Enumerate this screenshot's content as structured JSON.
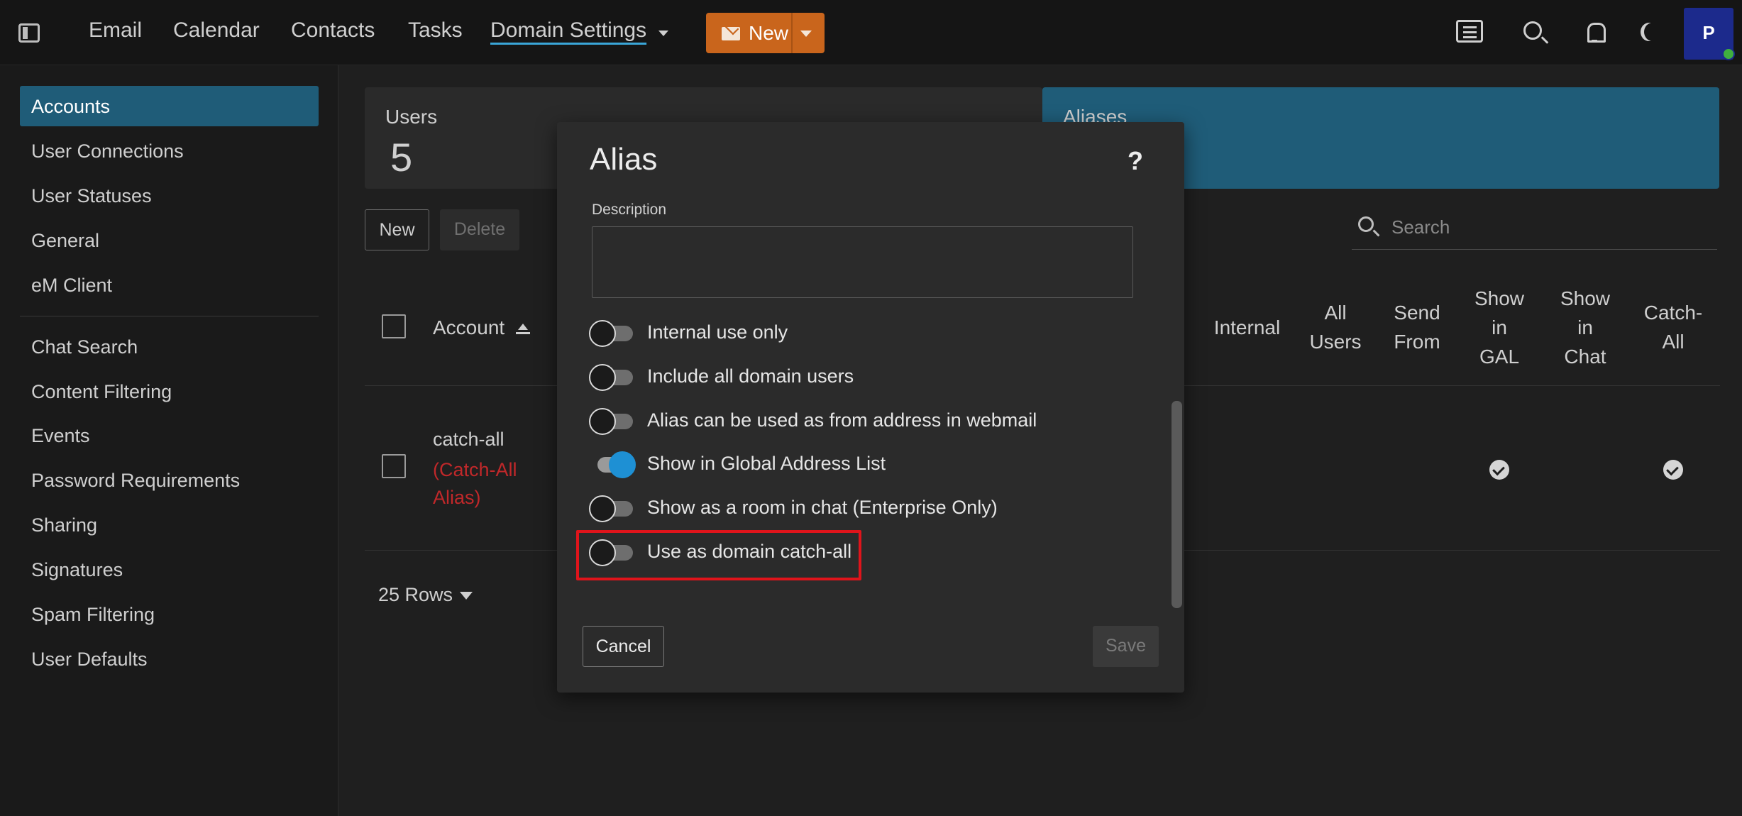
{
  "topbar": {
    "nav": [
      "Email",
      "Calendar",
      "Contacts",
      "Tasks",
      "Domain Settings"
    ],
    "new_label": "New",
    "avatar_initial": "P",
    "accent_color": "#c9651c"
  },
  "sidebar": {
    "group1": [
      "Accounts",
      "User Connections",
      "User Statuses",
      "General",
      "eM Client"
    ],
    "group2": [
      "Chat Search",
      "Content Filtering",
      "Events",
      "Password Requirements",
      "Sharing",
      "Signatures",
      "Spam Filtering",
      "User Defaults"
    ]
  },
  "stats": {
    "users_label": "Users",
    "users_value": "5",
    "aliases_label": "Aliases"
  },
  "toolbar": {
    "new_label": "New",
    "delete_label": "Delete",
    "search_placeholder": "Search"
  },
  "table": {
    "columns": [
      "Account",
      "Internal",
      "All Users",
      "Send From",
      "Show in GAL",
      "Show in Chat",
      "Catch-All"
    ],
    "rows": [
      {
        "name": "catch-all",
        "tag": "(Catch-All Alias)",
        "show_in_gal": true,
        "catch_all": true
      }
    ],
    "rows_per_page": "25 Rows"
  },
  "dialog": {
    "title": "Alias",
    "help": "?",
    "description_label": "Description",
    "description_value": "",
    "toggles": [
      {
        "label": "Internal use only",
        "on": false
      },
      {
        "label": "Include all domain users",
        "on": false
      },
      {
        "label": "Alias can be used as from address in webmail",
        "on": false
      },
      {
        "label": "Show in Global Address List",
        "on": true
      },
      {
        "label": "Show as a room in chat (Enterprise Only)",
        "on": false
      },
      {
        "label": "Use as domain catch-all",
        "on": false
      }
    ],
    "cancel_label": "Cancel",
    "save_label": "Save",
    "highlight_color": "#e0141b",
    "toggle_on_color": "#1e90d4"
  }
}
